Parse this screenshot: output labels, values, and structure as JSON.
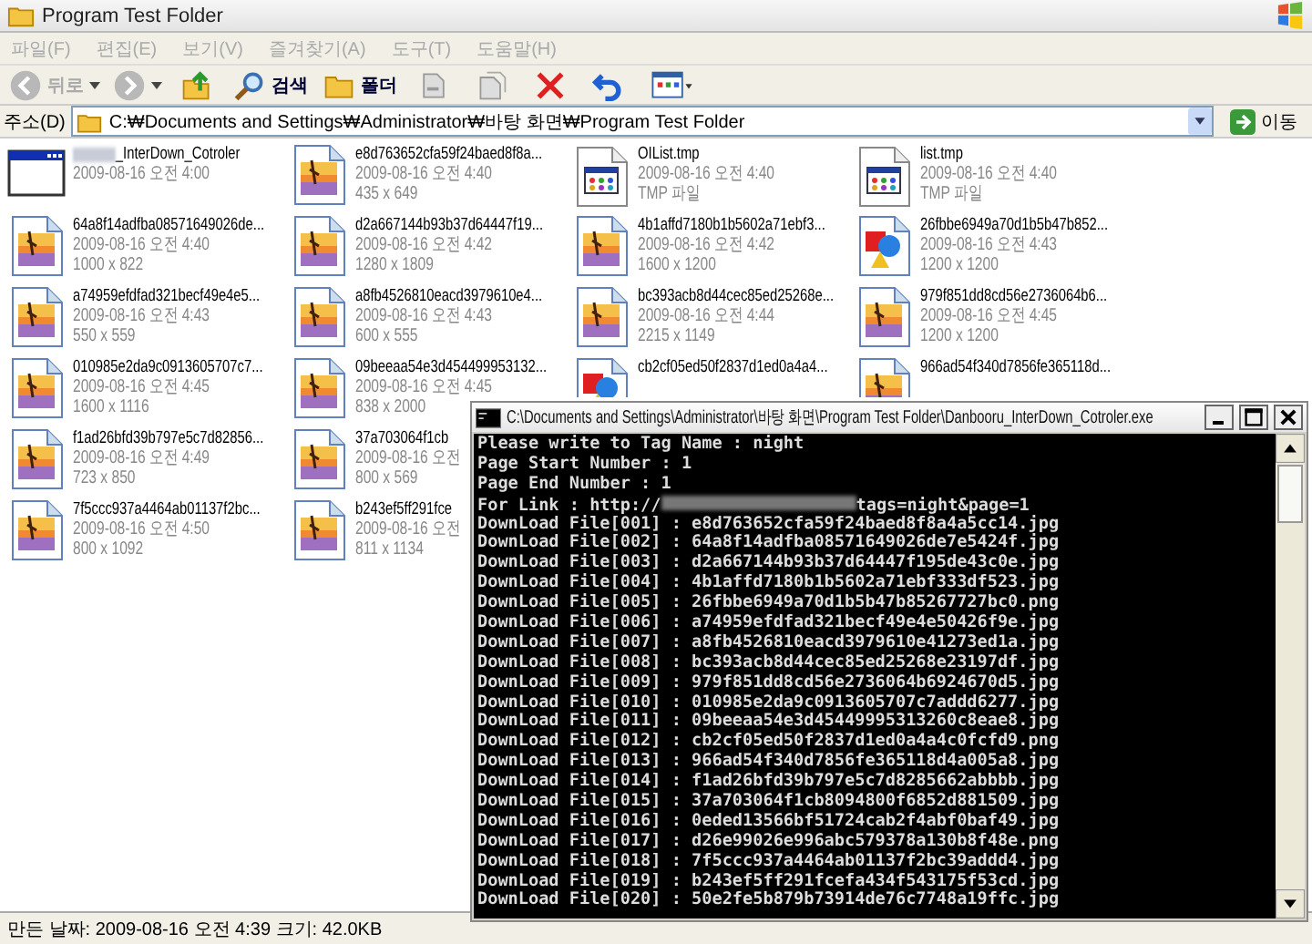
{
  "window": {
    "title": "Program Test Folder",
    "active": false
  },
  "menu": [
    "파일(F)",
    "편집(E)",
    "보기(V)",
    "즐겨찾기(A)",
    "도구(T)",
    "도움말(H)"
  ],
  "toolbar": {
    "back": {
      "label": "뒤로",
      "disabled": true
    },
    "forward": {
      "disabled": true
    },
    "search": "검색",
    "folders": "폴더"
  },
  "address": {
    "label": "주소(D)",
    "value": "C:₩Documents and Settings₩Administrator₩바탕 화면₩Program Test Folder",
    "go": "이동"
  },
  "files": [
    {
      "kind": "exe",
      "name": "_InterDown_Cotroler",
      "redacted": true,
      "date": "2009-08-16 오전 4:00"
    },
    {
      "kind": "image",
      "name": "e8d763652cfa59f24baed8f8a...",
      "date": "2009-08-16 오전 4:40",
      "info": "435 x 649"
    },
    {
      "kind": "tmp",
      "name": "OIList.tmp",
      "date": "2009-08-16 오전 4:40",
      "info": "TMP 파일"
    },
    {
      "kind": "tmp",
      "name": "list.tmp",
      "date": "2009-08-16 오전 4:40",
      "info": "TMP 파일"
    },
    {
      "kind": "image",
      "name": "64a8f14adfba08571649026de...",
      "date": "2009-08-16 오전 4:40",
      "info": "1000 x 822"
    },
    {
      "kind": "image",
      "name": "d2a667144b93b37d64447f19...",
      "date": "2009-08-16 오전 4:42",
      "info": "1280 x 1809"
    },
    {
      "kind": "image",
      "name": "4b1affd7180b1b5602a71ebf3...",
      "date": "2009-08-16 오전 4:42",
      "info": "1600 x 1200"
    },
    {
      "kind": "png",
      "name": "26fbbe6949a70d1b5b47b852...",
      "date": "2009-08-16 오전 4:43",
      "info": "1200 x 1200"
    },
    {
      "kind": "image",
      "name": "a74959efdfad321becf49e4e5...",
      "date": "2009-08-16 오전 4:43",
      "info": "550 x 559"
    },
    {
      "kind": "image",
      "name": "a8fb4526810eacd3979610e4...",
      "date": "2009-08-16 오전 4:43",
      "info": "600 x 555"
    },
    {
      "kind": "image",
      "name": "bc393acb8d44cec85ed25268e...",
      "date": "2009-08-16 오전 4:44",
      "info": "2215 x 1149"
    },
    {
      "kind": "image",
      "name": "979f851dd8cd56e2736064b6...",
      "date": "2009-08-16 오전 4:45",
      "info": "1200 x 1200"
    },
    {
      "kind": "image",
      "name": "010985e2da9c0913605707c7...",
      "date": "2009-08-16 오전 4:45",
      "info": "1600 x 1116"
    },
    {
      "kind": "image",
      "name": "09beeaa54e3d454499953132...",
      "date": "2009-08-16 오전 4:45",
      "info": "838 x 2000"
    },
    {
      "kind": "png",
      "name": "cb2cf05ed50f2837d1ed0a4a4..."
    },
    {
      "kind": "image",
      "name": "966ad54f340d7856fe365118d..."
    },
    {
      "kind": "image",
      "name": "f1ad26bfd39b797e5c7d82856...",
      "date": "2009-08-16 오전 4:49",
      "info": "723 x 850"
    },
    {
      "kind": "image",
      "name": "37a703064f1cb",
      "date": "2009-08-16 오전",
      "info": "800 x 569"
    },
    {
      "kind": "blank"
    },
    {
      "kind": "blank"
    },
    {
      "kind": "image",
      "name": "7f5ccc937a4464ab01137f2bc...",
      "date": "2009-08-16 오전 4:50",
      "info": "800 x 1092"
    },
    {
      "kind": "image",
      "name": "b243ef5ff291fce",
      "date": "2009-08-16 오전",
      "info": "811 x 1134"
    }
  ],
  "status_bar": "만든 날짜: 2009-08-16 오전 4:39 크기: 42.0KB",
  "console": {
    "title": "C:\\Documents and Settings\\Administrator\\바탕 화면\\Program Test Folder\\Danbooru_InterDown_Cotroler.exe",
    "lines": [
      {
        "text": "Please write to Tag Name : night"
      },
      {
        "text": "Page Start Number : 1"
      },
      {
        "text": "Page End Number : 1"
      },
      {
        "text": "For Link : http://",
        "redacted": true,
        "after": "tags=night&page=1"
      },
      {
        "text": "DownLoad File[001] : e8d763652cfa59f24baed8f8a4a5cc14.jpg"
      },
      {
        "text": "DownLoad File[002] : 64a8f14adfba08571649026de7e5424f.jpg"
      },
      {
        "text": "DownLoad File[003] : d2a667144b93b37d64447f195de43c0e.jpg"
      },
      {
        "text": "DownLoad File[004] : 4b1affd7180b1b5602a71ebf333df523.jpg"
      },
      {
        "text": "DownLoad File[005] : 26fbbe6949a70d1b5b47b85267727bc0.png"
      },
      {
        "text": "DownLoad File[006] : a74959efdfad321becf49e4e50426f9e.jpg"
      },
      {
        "text": "DownLoad File[007] : a8fb4526810eacd3979610e41273ed1a.jpg"
      },
      {
        "text": "DownLoad File[008] : bc393acb8d44cec85ed25268e23197df.jpg"
      },
      {
        "text": "DownLoad File[009] : 979f851dd8cd56e2736064b6924670d5.jpg"
      },
      {
        "text": "DownLoad File[010] : 010985e2da9c0913605707c7addd6277.jpg"
      },
      {
        "text": "DownLoad File[011] : 09beeaa54e3d45449995313260c8eae8.jpg"
      },
      {
        "text": "DownLoad File[012] : cb2cf05ed50f2837d1ed0a4a4c0fcfd9.png"
      },
      {
        "text": "DownLoad File[013] : 966ad54f340d7856fe365118d4a005a8.jpg"
      },
      {
        "text": "DownLoad File[014] : f1ad26bfd39b797e5c7d8285662abbbb.jpg"
      },
      {
        "text": "DownLoad File[015] : 37a703064f1cb8094800f6852d881509.jpg"
      },
      {
        "text": "DownLoad File[016] : 0eded13566bf51724cab2f4abf0baf49.jpg"
      },
      {
        "text": "DownLoad File[017] : d26e99026e996abc579378a130b8f48e.png"
      },
      {
        "text": "DownLoad File[018] : 7f5ccc937a4464ab01137f2bc39addd4.jpg"
      },
      {
        "text": "DownLoad File[019] : b243ef5ff291fcefa434f543175f53cd.jpg"
      },
      {
        "text": "DownLoad File[020] : 50e2fe5b879b73914de76c7748a19ffc.jpg"
      }
    ]
  }
}
